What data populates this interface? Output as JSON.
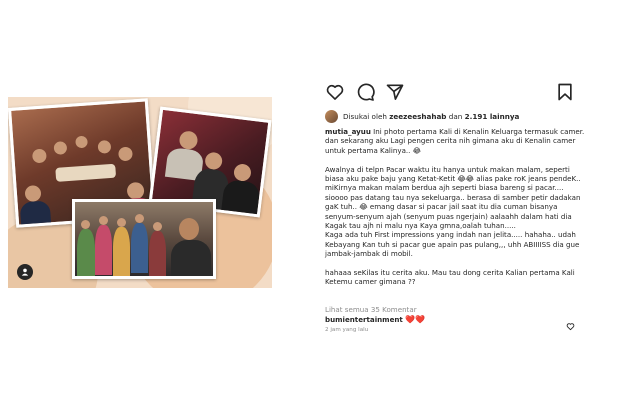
{
  "post": {
    "liked_by_prefix": "Disukai oleh",
    "liked_by_user": "zeezeeshahab",
    "liked_by_and": "dan",
    "liked_by_count": "2.191 lainnya",
    "author": "mutia_ayuu",
    "caption_lines": [
      " Ini photo pertama Kali di Kenalin Keluarga termasuk camer.",
      "dan sekarang aku Lagi pengen cerita nih gimana aku di Kenalin camer untuk pertama Kalinya.. 😂",
      "",
      "Awalnya di telpn Pacar waktu itu hanya untuk makan malam, seperti biasa aku pake baju yang Ketat-Ketit 😂😂 alias pake roK jeans pendeK.. miKirnya makan malam berdua ajh seperti biasa bareng si pacar....",
      "sioooo pas datang tau nya sekeluarga.. berasa di samber petir dadakan gaK tuh.. 😂 emang dasar si pacar jail saat itu dia cuman bisanya senyum-senyum ajah (senyum puas ngerjain) aalaahh dalam hati dia Kagak tau ajh ni malu nya Kaya gmna,oalah tuhan.....",
      "Kaga ada tuh First impressions yang indah nan jelita..... hahaha.. udah Kebayang Kan tuh si pacar gue apain pas pulang,,, uhh ABIIIISS dia gue jambak-jambak di mobil.",
      "",
      "hahaaa seKilas itu cerita aku. Mau tau dong cerita Kalian pertama Kali Ketemu camer gimana ??"
    ],
    "view_comments": "Lihat semua 35 Komentar",
    "comment_user": "bumientertainment",
    "comment_text": "❤️❤️",
    "timestamp": "2 jam yang lalu"
  },
  "icons": [
    "heart-icon",
    "comment-icon",
    "share-icon",
    "bookmark-icon",
    "tagged-people-icon"
  ],
  "colors": {
    "accent_red": "#ed4956",
    "muted": "#8e8e8e",
    "text": "#262626",
    "image_bg": "#f3dcc6"
  }
}
